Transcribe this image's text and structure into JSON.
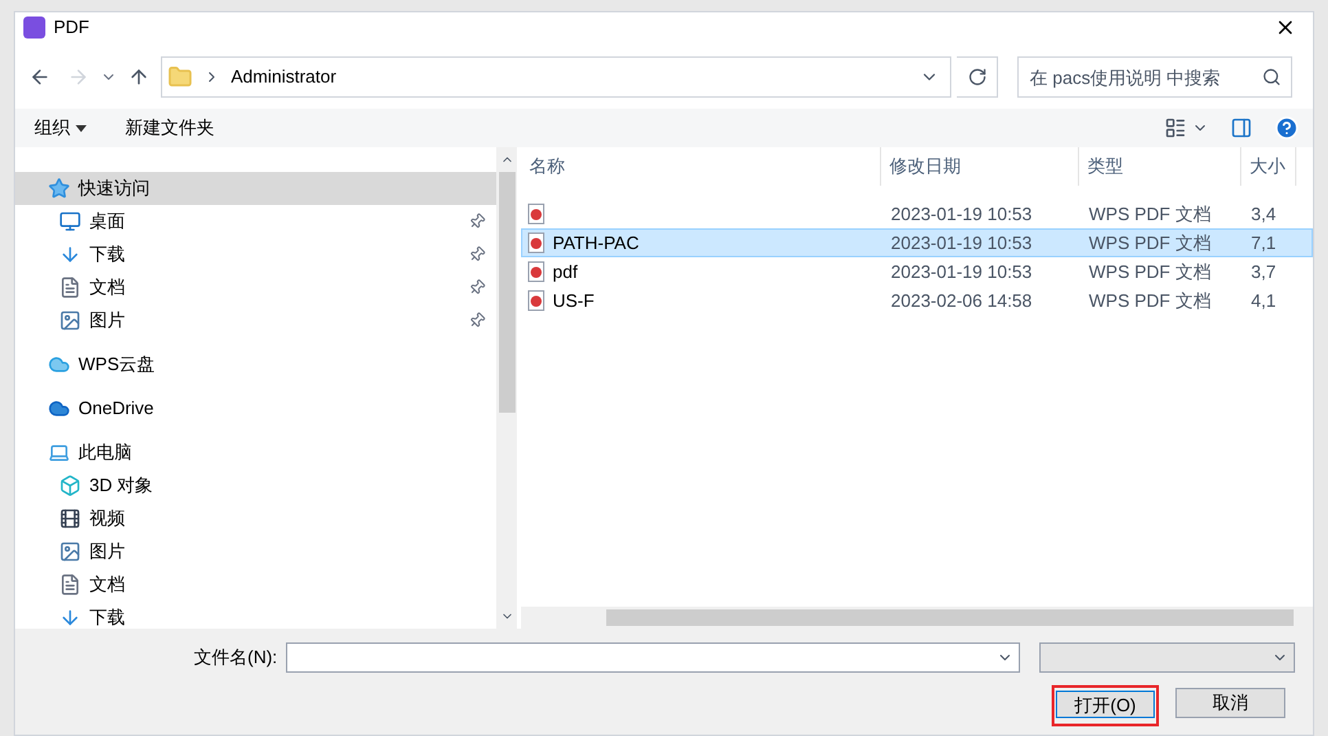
{
  "window": {
    "title": "PDF"
  },
  "address_bar": {
    "path": [
      "Administrator"
    ],
    "search_placeholder": "在 pacs使用说明 中搜索"
  },
  "toolbar": {
    "organize": "组织",
    "new_folder": "新建文件夹"
  },
  "sidebar": {
    "items": [
      {
        "label": "快速访问",
        "kind": "star",
        "selected": true,
        "children": [
          {
            "label": "桌面",
            "kind": "desktop",
            "selected": false,
            "pinned": true
          },
          {
            "label": "下载",
            "kind": "download",
            "selected": false,
            "pinned": true
          },
          {
            "label": "文档",
            "kind": "document",
            "selected": false,
            "pinned": true
          },
          {
            "label": "图片",
            "kind": "picture",
            "selected": false,
            "pinned": true
          }
        ]
      },
      {
        "label": "WPS云盘",
        "kind": "cloud",
        "selected": false
      },
      {
        "label": "OneDrive",
        "kind": "onedrive",
        "selected": false
      },
      {
        "label": "此电脑",
        "kind": "pc",
        "selected": false,
        "children": [
          {
            "label": "3D 对象",
            "kind": "cube",
            "selected": false,
            "pinned": false
          },
          {
            "label": "视频",
            "kind": "video",
            "selected": false,
            "pinned": false
          },
          {
            "label": "图片",
            "kind": "picture",
            "selected": false,
            "pinned": false
          },
          {
            "label": "文档",
            "kind": "document",
            "selected": false,
            "pinned": false
          },
          {
            "label": "下载",
            "kind": "download",
            "selected": false,
            "pinned": false
          }
        ]
      }
    ]
  },
  "file_list": {
    "columns": [
      "名称",
      "修改日期",
      "类型",
      "大小"
    ],
    "rows": [
      {
        "name": "",
        "date": "2023-01-19 10:53",
        "type": "WPS PDF 文档",
        "size": "3,4",
        "selected": false
      },
      {
        "name": "PATH-PAC",
        "date": "2023-01-19 10:53",
        "type": "WPS PDF 文档",
        "size": "7,1",
        "selected": true
      },
      {
        "name": "pdf",
        "date": "2023-01-19 10:53",
        "type": "WPS PDF 文档",
        "size": "3,7",
        "selected": false
      },
      {
        "name": "US-F",
        "date": "2023-02-06 14:58",
        "type": "WPS PDF 文档",
        "size": "4,1",
        "selected": false
      }
    ]
  },
  "footer": {
    "filename_label": "文件名(N):",
    "open_button": "打开(O)",
    "cancel_button": "取消"
  }
}
